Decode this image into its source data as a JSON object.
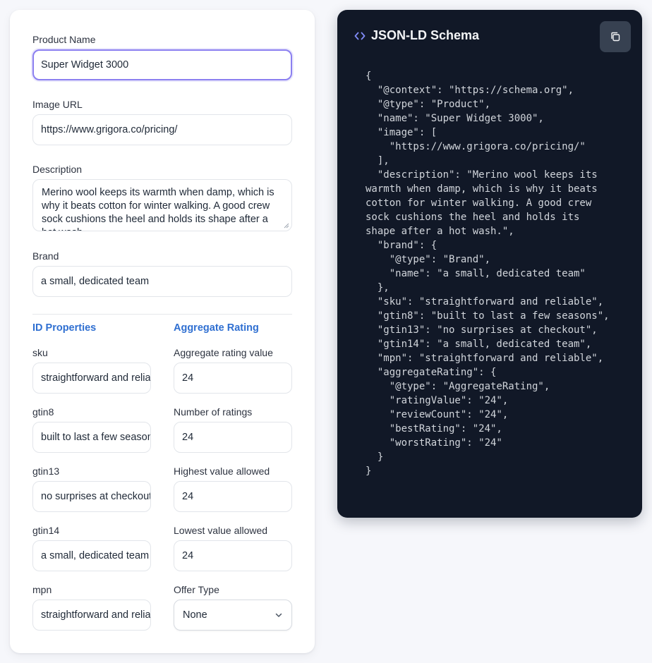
{
  "form": {
    "product_name": {
      "label": "Product Name",
      "value": "Super Widget 3000"
    },
    "image_url": {
      "label": "Image URL",
      "value": "https://www.grigora.co/pricing/"
    },
    "description": {
      "label": "Description",
      "value": "Merino wool keeps its warmth when damp, which is why it beats cotton for winter walking. A good crew sock cushions the heel and holds its shape after a hot wash."
    },
    "brand": {
      "label": "Brand",
      "value": "a small, dedicated team"
    }
  },
  "id_properties": {
    "title": "ID Properties",
    "sku": {
      "label": "sku",
      "value": "straightforward and reliable"
    },
    "gtin8": {
      "label": "gtin8",
      "value": "built to last a few seasons"
    },
    "gtin13": {
      "label": "gtin13",
      "value": "no surprises at checkout"
    },
    "gtin14": {
      "label": "gtin14",
      "value": "a small, dedicated team"
    },
    "mpn": {
      "label": "mpn",
      "value": "straightforward and reliable"
    }
  },
  "aggregate_rating": {
    "title": "Aggregate Rating",
    "rating_value": {
      "label": "Aggregate rating value",
      "value": "24"
    },
    "review_count": {
      "label": "Number of ratings",
      "value": "24"
    },
    "best_rating": {
      "label": "Highest value allowed",
      "value": "24"
    },
    "worst_rating": {
      "label": "Lowest value allowed",
      "value": "24"
    },
    "offer_type": {
      "label": "Offer Type",
      "value": "None"
    }
  },
  "schema_panel": {
    "title": "JSON-LD Schema",
    "code": "{\n  \"@context\": \"https://schema.org\",\n  \"@type\": \"Product\",\n  \"name\": \"Super Widget 3000\",\n  \"image\": [\n    \"https://www.grigora.co/pricing/\"\n  ],\n  \"description\": \"Merino wool keeps its\nwarmth when damp, which is why it beats\ncotton for winter walking. A good crew\nsock cushions the heel and holds its\nshape after a hot wash.\",\n  \"brand\": {\n    \"@type\": \"Brand\",\n    \"name\": \"a small, dedicated team\"\n  },\n  \"sku\": \"straightforward and reliable\",\n  \"gtin8\": \"built to last a few seasons\",\n  \"gtin13\": \"no surprises at checkout\",\n  \"gtin14\": \"a small, dedicated team\",\n  \"mpn\": \"straightforward and reliable\",\n  \"aggregateRating\": {\n    \"@type\": \"AggregateRating\",\n    \"ratingValue\": \"24\",\n    \"reviewCount\": \"24\",\n    \"bestRating\": \"24\",\n    \"worstRating\": \"24\"\n  }\n}"
  },
  "colors": {
    "page_bg": "#f6f7fb",
    "accent_blue": "#2f6fd1",
    "focus_ring": "#8b7ff0",
    "code_bg": "#111827",
    "code_icon": "#818cf8"
  },
  "icons": {
    "title_icon": "code-brackets-icon",
    "copy_icon": "copy-icon",
    "select_icon": "chevron-down-icon"
  }
}
